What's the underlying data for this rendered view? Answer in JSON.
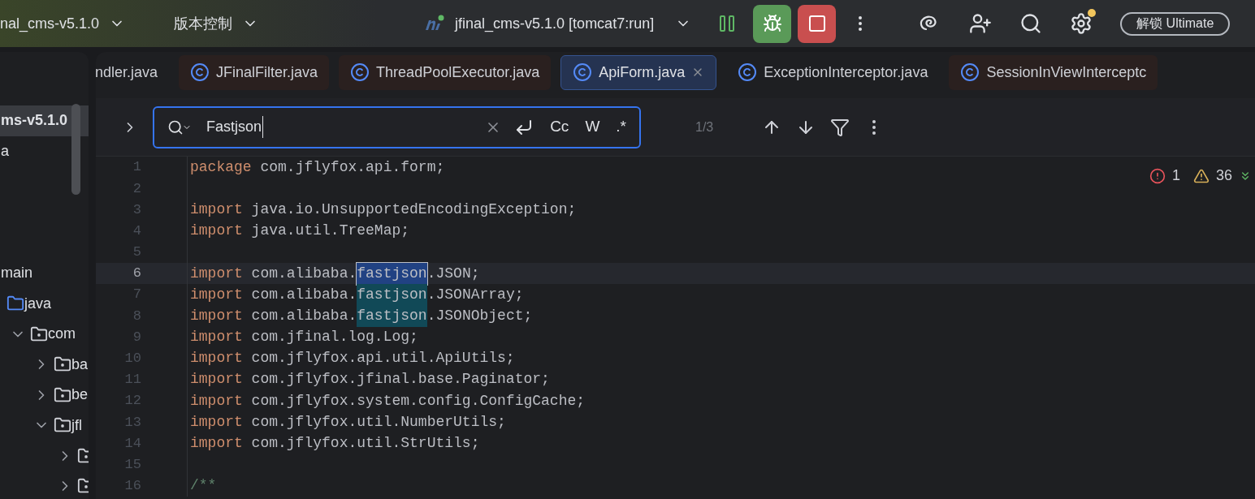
{
  "top_bar": {
    "project": "nal_cms-v5.1.0",
    "vcs": "版本控制",
    "run_config": "jfinal_cms-v5.1.0 [tomcat7:run]",
    "unlock_button": "解锁 Ultimate",
    "settings_badge": true
  },
  "project_tree": [
    {
      "kind": "module",
      "label": "ms-v5.1.0",
      "selected": true
    },
    {
      "kind": "plain",
      "label": "a",
      "selected": false
    },
    {
      "kind": "plain",
      "label": "main",
      "selected": false,
      "children": [
        {
          "kind": "source_root",
          "label": "java",
          "selected": false,
          "children": [
            {
              "kind": "package",
              "label": "com",
              "selected": false,
              "expanded": true,
              "children": [
                {
                  "kind": "package",
                  "label": "ba",
                  "selected": false,
                  "expanded": false
                },
                {
                  "kind": "package",
                  "label": "be",
                  "selected": false,
                  "expanded": false
                },
                {
                  "kind": "package",
                  "label": "jfl",
                  "selected": false,
                  "expanded": true,
                  "children": [
                    {
                      "kind": "package",
                      "selected": false,
                      "expanded": false
                    },
                    {
                      "kind": "package",
                      "selected": false,
                      "expanded": false
                    }
                  ]
                }
              ]
            }
          ]
        }
      ]
    }
  ],
  "tabs": [
    {
      "label": "ndler.java",
      "selected": false,
      "tinted": false,
      "icon": false
    },
    {
      "label": "JFinalFilter.java",
      "selected": false,
      "tinted": true,
      "icon": true
    },
    {
      "label": "ThreadPoolExecutor.java",
      "selected": false,
      "tinted": true,
      "icon": true
    },
    {
      "label": "ApiForm.java",
      "selected": true,
      "tinted": false,
      "icon": true
    },
    {
      "label": "ExceptionInterceptor.java",
      "selected": false,
      "tinted": false,
      "icon": true
    },
    {
      "label": "SessionInViewInterceptc",
      "selected": false,
      "tinted": true,
      "icon": true
    }
  ],
  "find_bar": {
    "value": "Fastjson",
    "options": [
      "Cc",
      "W",
      ".*"
    ],
    "count": "1/3"
  },
  "inspections": {
    "errors": "1",
    "warnings": "36"
  },
  "code": [
    {
      "number": "1",
      "current": false,
      "tokens": [
        {
          "kind": "keyword",
          "text": "package"
        },
        {
          "kind": "plain",
          "text": " com.jflyfox.api.form;"
        }
      ]
    },
    {
      "number": "2",
      "current": false
    },
    {
      "number": "3",
      "current": false,
      "tokens": [
        {
          "kind": "keyword",
          "text": "import"
        },
        {
          "kind": "plain",
          "text": " java.io.UnsupportedEncodingException;"
        }
      ]
    },
    {
      "number": "4",
      "current": false,
      "tokens": [
        {
          "kind": "keyword",
          "text": "import"
        },
        {
          "kind": "plain",
          "text": " java.util.TreeMap;"
        }
      ]
    },
    {
      "number": "5",
      "current": false
    },
    {
      "number": "6",
      "current": true,
      "tokens": [
        {
          "kind": "keyword",
          "text": "import"
        },
        {
          "kind": "plain",
          "text": " com.alibaba."
        },
        {
          "kind": "current_match",
          "text": "fastjson"
        },
        {
          "kind": "plain",
          "text": ".JSON;"
        }
      ]
    },
    {
      "number": "7",
      "current": false,
      "tokens": [
        {
          "kind": "keyword",
          "text": "import"
        },
        {
          "kind": "plain",
          "text": " com.alibaba."
        },
        {
          "kind": "match",
          "text": "fastjson"
        },
        {
          "kind": "plain",
          "text": ".JSONArray;"
        }
      ]
    },
    {
      "number": "8",
      "current": false,
      "tokens": [
        {
          "kind": "keyword",
          "text": "import"
        },
        {
          "kind": "plain",
          "text": " com.alibaba."
        },
        {
          "kind": "match",
          "text": "fastjson"
        },
        {
          "kind": "plain",
          "text": ".JSONObject;"
        }
      ]
    },
    {
      "number": "9",
      "current": false,
      "tokens": [
        {
          "kind": "keyword",
          "text": "import"
        },
        {
          "kind": "plain",
          "text": " com.jfinal.log.Log;"
        }
      ]
    },
    {
      "number": "10",
      "current": false,
      "tokens": [
        {
          "kind": "keyword",
          "text": "import"
        },
        {
          "kind": "plain",
          "text": " com.jflyfox.api.util.ApiUtils;"
        }
      ]
    },
    {
      "number": "11",
      "current": false,
      "tokens": [
        {
          "kind": "keyword",
          "text": "import"
        },
        {
          "kind": "plain",
          "text": " com.jflyfox.jfinal.base.Paginator;"
        }
      ]
    },
    {
      "number": "12",
      "current": false,
      "tokens": [
        {
          "kind": "keyword",
          "text": "import"
        },
        {
          "kind": "plain",
          "text": " com.jflyfox.system.config.ConfigCache;"
        }
      ]
    },
    {
      "number": "13",
      "current": false,
      "tokens": [
        {
          "kind": "keyword",
          "text": "import"
        },
        {
          "kind": "plain",
          "text": " com.jflyfox.util.NumberUtils;"
        }
      ]
    },
    {
      "number": "14",
      "current": false,
      "tokens": [
        {
          "kind": "keyword",
          "text": "import"
        },
        {
          "kind": "plain",
          "text": " com.jflyfox.util.StrUtils;"
        }
      ]
    },
    {
      "number": "15",
      "current": false
    },
    {
      "number": "16",
      "current": false,
      "tokens": [
        {
          "kind": "comment",
          "text": "/**"
        }
      ]
    }
  ]
}
